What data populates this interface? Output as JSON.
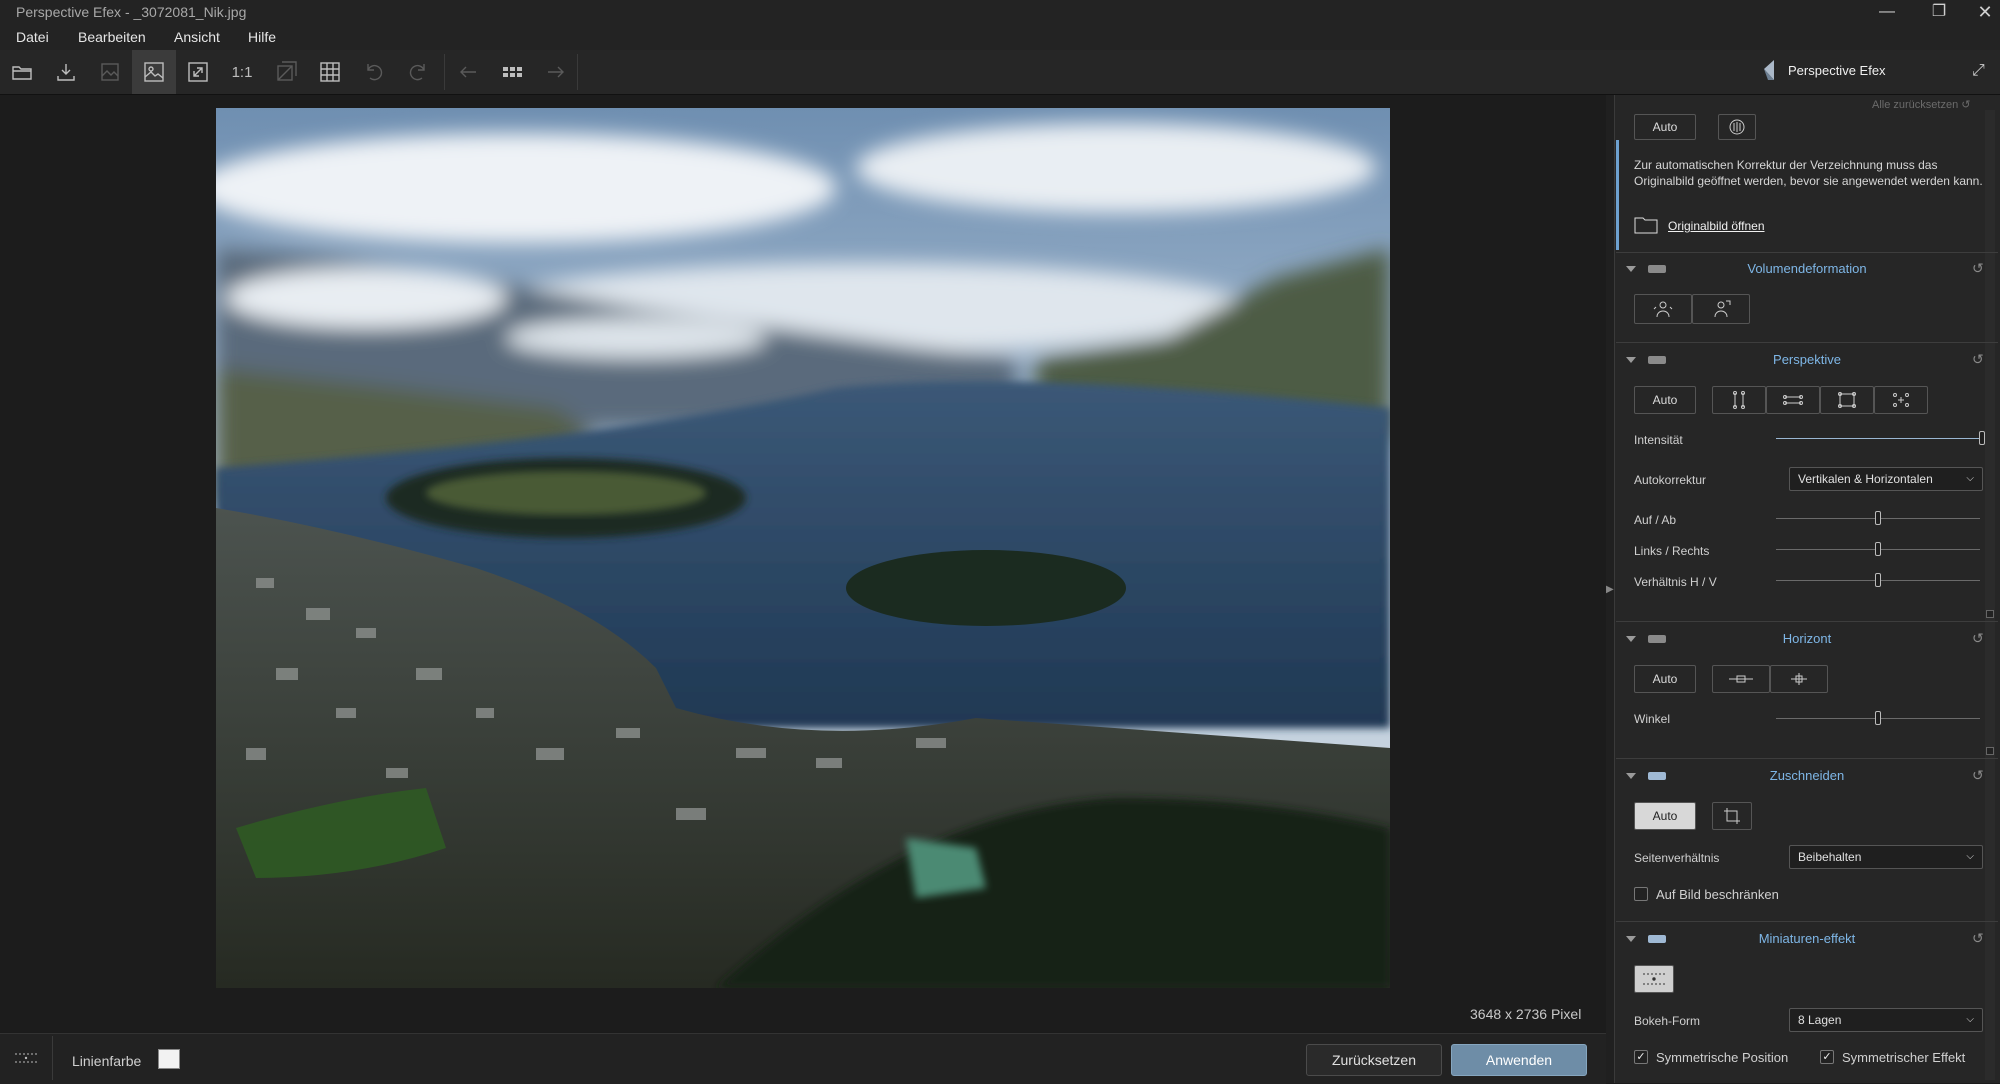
{
  "window": {
    "title": "Perspective Efex - _3072081_Nik.jpg"
  },
  "menu": [
    "Datei",
    "Bearbeiten",
    "Ansicht",
    "Hilfe"
  ],
  "toolbar": {
    "one_to_one": "1:1",
    "brand": "Perspective Efex"
  },
  "canvas": {
    "dimensions": "3648 x 2736 Pixel"
  },
  "bottom": {
    "line_color_label": "Linienfarbe",
    "reset": "Zurücksetzen",
    "apply": "Anwenden"
  },
  "panel": {
    "reset_all": "Alle zurücksetzen",
    "lens": {
      "auto": "Auto",
      "info": "Zur automatischen Korrektur der Verzeichnung muss das Originalbild geöffnet werden, bevor sie angewendet werden kann.",
      "open_original": "Originalbild öffnen"
    },
    "volume": {
      "title": "Volumendeformation"
    },
    "perspective": {
      "title": "Perspektive",
      "auto": "Auto",
      "intensity": "Intensität",
      "autocorrect": "Autokorrektur",
      "autocorrect_value": "Vertikalen & Horizontalen",
      "up_down": "Auf / Ab",
      "left_right": "Links / Rechts",
      "ratio": "Verhältnis H / V",
      "intensity_level": 1.0,
      "up_down_level": 0.5,
      "left_right_level": 0.5,
      "ratio_level": 0.5
    },
    "horizon": {
      "title": "Horizont",
      "auto": "Auto",
      "angle": "Winkel",
      "angle_level": 0.5
    },
    "crop": {
      "title": "Zuschneiden",
      "auto": "Auto",
      "aspect": "Seitenverhältnis",
      "aspect_value": "Beibehalten",
      "constrain": "Auf Bild beschränken"
    },
    "miniature": {
      "title": "Miniaturen-effekt",
      "bokeh": "Bokeh-Form",
      "bokeh_value": "8 Lagen",
      "sym_position": "Symmetrische Position",
      "sym_effect": "Symmetrischer Effekt"
    }
  },
  "colors": {
    "accent": "#7eb6e6",
    "apply_button": "#6e8da7"
  }
}
